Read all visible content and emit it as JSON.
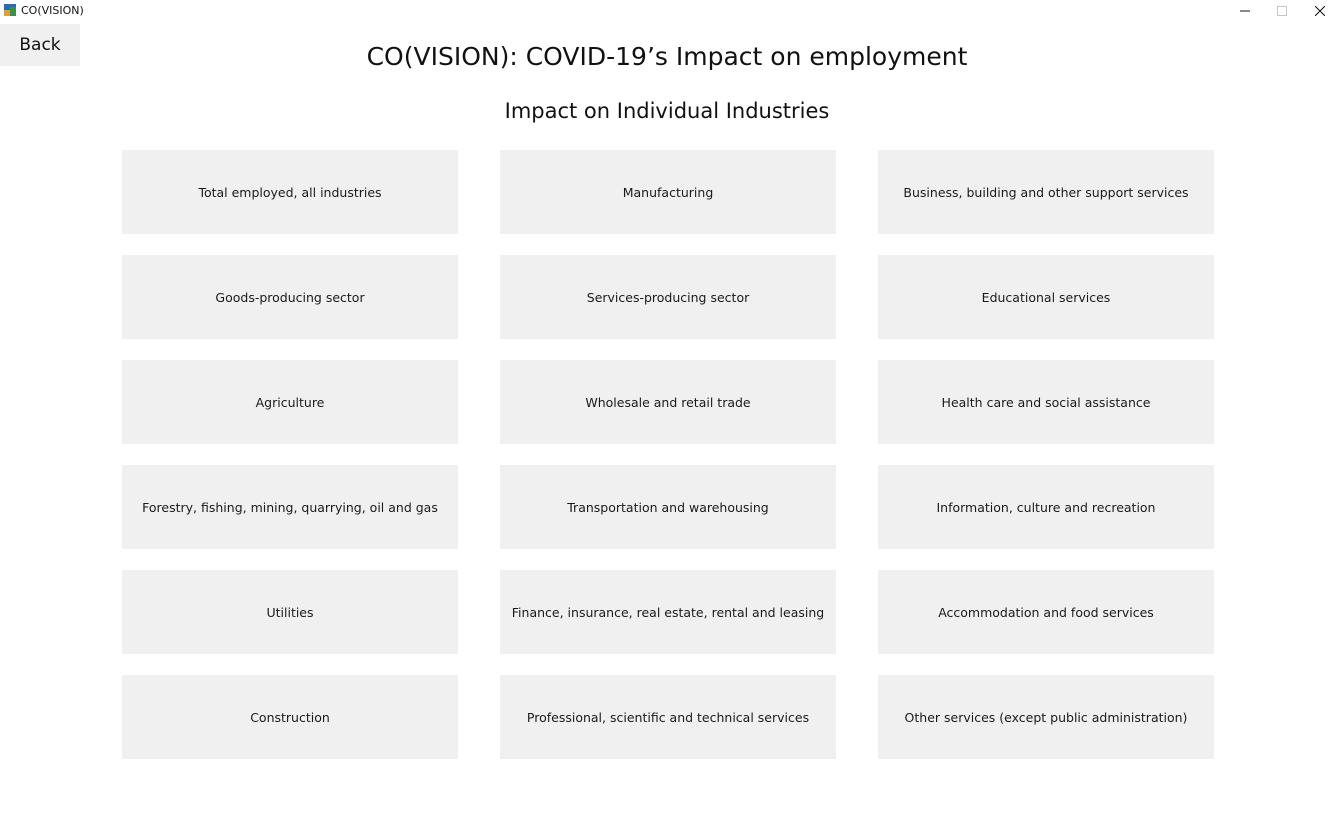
{
  "window": {
    "title": "CO(VISION)",
    "controls": {
      "minimize": "–",
      "maximize": "□",
      "close": "✕"
    }
  },
  "nav": {
    "back_label": "Back"
  },
  "header": {
    "title": "CO(VISION): COVID-19’s Impact on employment",
    "subtitle": "Impact on Individual Industries"
  },
  "industries": [
    "Total employed, all industries",
    "Manufacturing",
    "Business, building and other support services",
    "Goods-producing sector",
    "Services-producing sector",
    "Educational services",
    "Agriculture",
    "Wholesale and retail trade",
    "Health care and social assistance",
    "Forestry, fishing, mining, quarrying, oil and gas",
    "Transportation and warehousing",
    "Information, culture and recreation",
    "Utilities",
    "Finance, insurance, real estate, rental and leasing",
    "Accommodation and food services",
    "Construction",
    "Professional, scientific and technical services",
    "Other services (except public administration)"
  ],
  "colors": {
    "button_bg": "#f0f0f0",
    "page_bg": "#ffffff",
    "text": "#111111"
  }
}
